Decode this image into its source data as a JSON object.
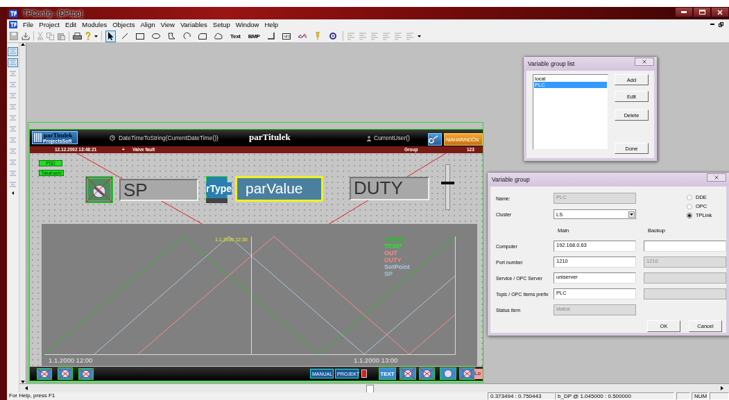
{
  "window": {
    "title": "TPConfig - [DP.tpp]"
  },
  "menu": [
    "File",
    "Project",
    "Edit",
    "Modules",
    "Objects",
    "Align",
    "View",
    "Variables",
    "Setup",
    "Window",
    "Help"
  ],
  "tools": [
    {
      "kind": "pointer",
      "selected": true
    },
    {
      "kind": "line",
      "selected": false
    },
    {
      "kind": "rect",
      "selected": false
    },
    {
      "kind": "ellipse",
      "selected": false
    },
    {
      "kind": "polygon",
      "selected": false
    },
    {
      "kind": "arc",
      "selected": false
    },
    {
      "kind": "roundrect",
      "selected": false
    },
    {
      "kind": "cloud",
      "selected": false
    },
    {
      "kind": "text",
      "label": "Text",
      "selected": false
    },
    {
      "kind": "text",
      "label": "BMP",
      "selected": false
    },
    {
      "kind": "corner",
      "selected": false
    },
    {
      "kind": "numeric",
      "selected": false
    },
    {
      "kind": "trend",
      "selected": false
    },
    {
      "kind": "alarm",
      "selected": false
    },
    {
      "kind": "link",
      "selected": false
    }
  ],
  "side_tools": [
    {
      "selected": true
    },
    {
      "selected": true
    },
    {
      "selected": false
    },
    {
      "selected": false
    },
    {
      "selected": false
    },
    {
      "selected": false
    },
    {
      "selected": false
    },
    {
      "selected": false
    },
    {
      "selected": false
    },
    {
      "selected": false
    },
    {
      "selected": false
    },
    {
      "selected": false
    },
    {
      "selected": false
    }
  ],
  "screen": {
    "caption": "parTitulek",
    "logo": "ProjectsSoft",
    "title": "parTitulek",
    "clock": "DateTimeToString(CurrentDateTime())",
    "user": "CurrentUser()",
    "shift_button": "NIAHAR/NOČN",
    "alarm": {
      "time": "12.12.2002 13:48:21",
      "sign": "+",
      "message": "Valve fault",
      "group": "Group",
      "count": "123"
    },
    "buttons": [
      "PSD",
      "Takahashi"
    ],
    "sp_display": "SP",
    "type_label": "rType",
    "value_display": "parValue",
    "duty_display": "DUTY",
    "slider": {
      "level": 0.62
    },
    "chart": {
      "cursor_label": "1.1.2000 12:30",
      "x_labels": [
        "1.1.2000 12:00",
        "1.1.2000 13:00"
      ],
      "legend": [
        {
          "name": "teplota",
          "color": "#22c022"
        },
        {
          "name": "TEMP",
          "color": "#2ee02e"
        },
        {
          "name": "OUT",
          "color": "#ff8a8a"
        },
        {
          "name": "DUTY",
          "color": "#ff8080"
        },
        {
          "name": "SotPoint",
          "color": "#a8c8e0"
        },
        {
          "name": "SP",
          "color": "#9cc0dc"
        }
      ]
    },
    "bottom_buttons": [
      "MANUAL",
      "PROJEKT"
    ],
    "text_button": "TEXT",
    "corner_label": "Lo"
  },
  "group_list": {
    "title": "Variable group list",
    "items": [
      {
        "label": "local",
        "selected": false
      },
      {
        "label": "PLC",
        "selected": true
      }
    ],
    "buttons": [
      "Add",
      "Edit",
      "Delete",
      "Done"
    ]
  },
  "group_dialog": {
    "title": "Variable group",
    "name": {
      "label": "Name:",
      "value": "PLC",
      "disabled": true
    },
    "cluster": {
      "label": "Cluster",
      "value": "LS"
    },
    "protocols": [
      {
        "label": "DDE",
        "selected": false
      },
      {
        "label": "OPC",
        "selected": false
      },
      {
        "label": "TPLink",
        "selected": true
      }
    ],
    "main_header": "Main",
    "backup_header": "Backup",
    "rows": [
      {
        "label": "Computer",
        "main": {
          "value": "192.168.0.63",
          "disabled": false
        },
        "backup": {
          "disabled": false
        }
      },
      {
        "label": "Port number",
        "main": {
          "value": "1210",
          "disabled": false
        },
        "backup": {
          "value": "1210",
          "disabled": true
        }
      },
      {
        "label": "Service / OPC Server",
        "main": {
          "value": "uniserver",
          "disabled": false
        },
        "backup": {
          "disabled": true
        }
      },
      {
        "label": "Topic / OPC Items prefix",
        "main": {
          "value": "PLC",
          "disabled": false
        },
        "backup": {
          "disabled": true
        }
      },
      {
        "label": "Status item",
        "main": {
          "value": "status",
          "disabled": true
        }
      }
    ],
    "buttons": [
      "OK",
      "Cancel"
    ]
  },
  "status_bar": [
    "For Help, press F1",
    "0.373494 : 0.750443",
    "b_DP @ 1.045000 : 0.500000",
    "NUM"
  ]
}
